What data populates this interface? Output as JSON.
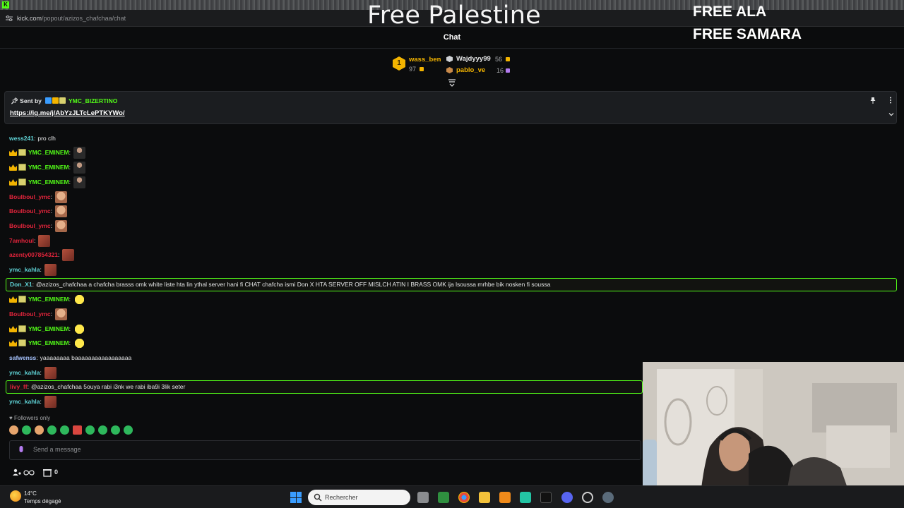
{
  "browser": {
    "favicon": "K",
    "url_domain": "kick.com",
    "url_path": "/popout/azizos_chafchaa/chat"
  },
  "overlay": {
    "title": "Free Palestine",
    "line1": "FREE ALA",
    "line2": "FREE SAMARA"
  },
  "chat": {
    "header": "Chat"
  },
  "leaderboard": {
    "first": {
      "rank": "1",
      "name": "wass_ben",
      "count": "97"
    },
    "second": {
      "name": "Wajdyyy99",
      "count": "56"
    },
    "third": {
      "name": "pablo_ve",
      "count": "16"
    }
  },
  "pinned": {
    "sent_by_label": "Sent by",
    "user": "YMC_BIZERTINO",
    "link": "https://ig.me/j/AbYzJLTcLePTKYWo/"
  },
  "messages": [
    {
      "user": "wess241",
      "color": "#5fd3d6",
      "text": "pro clh"
    },
    {
      "user": "YMC_EMINEM",
      "color": "#53fc18",
      "text": ""
    },
    {
      "user": "YMC_EMINEM",
      "color": "#53fc18",
      "text": ""
    },
    {
      "user": "YMC_EMINEM",
      "color": "#53fc18",
      "text": ""
    },
    {
      "user": "Boulboul_ymc",
      "color": "#e0243b",
      "text": ""
    },
    {
      "user": "Boulboul_ymc",
      "color": "#e0243b",
      "text": ""
    },
    {
      "user": "Boulboul_ymc",
      "color": "#e0243b",
      "text": ""
    },
    {
      "user": "7amhoul",
      "color": "#e0243b",
      "text": ""
    },
    {
      "user": "azenty007854321",
      "color": "#e0243b",
      "text": ""
    },
    {
      "user": "ymc_kahla",
      "color": "#5fd3d6",
      "text": ""
    },
    {
      "user": "Don_X1",
      "color": "#5fd3d6",
      "text": "@azizos_chafchaa a chafcha brasss omk white liste hta lin ythal server hani fi CHAT chafcha ismi Don X HTA SERVER OFF MISLCH ATIN I BRASS OMK ija lsoussa mrhbe bik nosken fi soussa"
    },
    {
      "user": "YMC_EMINEM",
      "color": "#53fc18",
      "text": ""
    },
    {
      "user": "Boulboul_ymc",
      "color": "#e0243b",
      "text": ""
    },
    {
      "user": "YMC_EMINEM",
      "color": "#53fc18",
      "text": ""
    },
    {
      "user": "YMC_EMINEM",
      "color": "#53fc18",
      "text": ""
    },
    {
      "user": "safwenss",
      "color": "#a7c4ff",
      "text": "yaaaaaaaa baaaaaaaaaaaaaaaaa"
    },
    {
      "user": "ymc_kahla",
      "color": "#5fd3d6",
      "text": ""
    },
    {
      "user": "livy_ff",
      "color": "#e0243b",
      "text": "@azizos_chafchaa 5ouya rabi i3nk we rabi iba9i 3lik seter"
    },
    {
      "user": "ymc_kahla",
      "color": "#5fd3d6",
      "text": ""
    }
  ],
  "followers_only": "Followers only",
  "input": {
    "placeholder": "Send a message"
  },
  "footer": {
    "count": "0"
  },
  "taskbar": {
    "temp": "14°C",
    "weather": "Temps dégagé",
    "search_placeholder": "Rechercher"
  },
  "colors": {
    "accent": "#53fc18",
    "background": "#0b0c0d"
  }
}
